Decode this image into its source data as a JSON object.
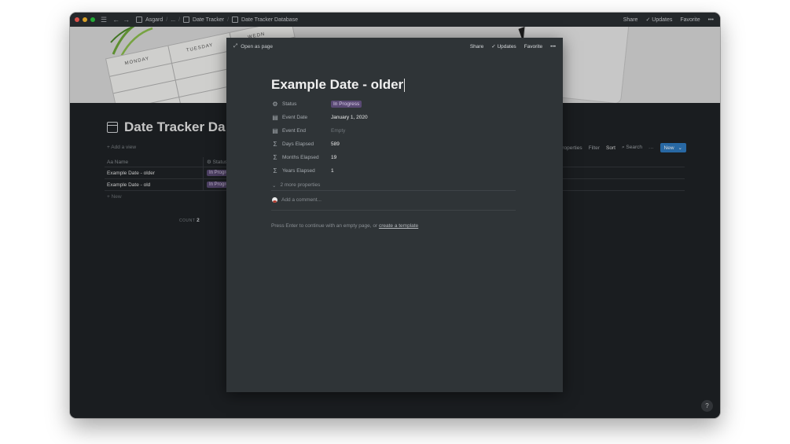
{
  "titlebar": {
    "breadcrumbs": [
      "Asgard",
      "...",
      "Date Tracker",
      "Date Tracker Database"
    ],
    "share": "Share",
    "updates": "Updates",
    "favorite": "Favorite",
    "more": "•••"
  },
  "cover": {
    "days": [
      "MONDAY",
      "TUESDAY",
      "WEDN"
    ]
  },
  "database": {
    "title": "Date Tracker Da",
    "add_view": "+ Add a view",
    "columns": [
      "Aa Name",
      "⚙ Status"
    ],
    "rows": [
      {
        "name": "Example Date - older",
        "status": "In Progre"
      },
      {
        "name": "Example Date - old",
        "status": "In Progre"
      }
    ],
    "new_row": "+ New",
    "count_label": "COUNT",
    "count_value": "2",
    "toolbar": {
      "properties": "Properties",
      "filter": "Filter",
      "sort": "Sort",
      "search": "Search",
      "more": "···",
      "new": "New"
    }
  },
  "modal": {
    "open_as_page": "Open as page",
    "share": "Share",
    "updates": "Updates",
    "favorite": "Favorite",
    "more": "•••",
    "title": "Example Date - older",
    "properties": [
      {
        "label": "Status",
        "value": "In Progress",
        "icon": "status-icon"
      },
      {
        "label": "Event Date",
        "value": "January 1, 2020",
        "icon": "calendar-icon"
      },
      {
        "label": "Event End",
        "value": "Empty",
        "icon": "calendar-icon"
      },
      {
        "label": "Days Elapsed",
        "value": "589",
        "icon": "formula-icon"
      },
      {
        "label": "Months Elapsed",
        "value": "19",
        "icon": "formula-icon"
      },
      {
        "label": "Years Elapsed",
        "value": "1",
        "icon": "formula-icon"
      }
    ],
    "more_properties": "2 more properties",
    "add_comment": "Add a comment...",
    "hint_prefix": "Press Enter to continue with an empty page, or",
    "hint_link": "create a template"
  },
  "help": "?",
  "colors": {
    "accent": "#2f7bc0",
    "tag_purple": "#5a4a74",
    "bg_dark": "#1f2326",
    "modal_bg": "#2f3437"
  }
}
